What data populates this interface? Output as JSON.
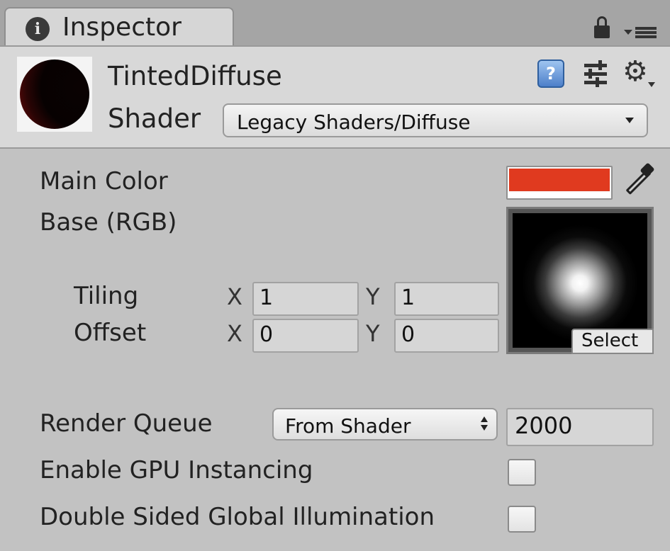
{
  "tab": {
    "title": "Inspector",
    "info_glyph": "i"
  },
  "header": {
    "material_name": "TintedDiffuse",
    "shader_label": "Shader",
    "shader_value": "Legacy Shaders/Diffuse",
    "help_glyph": "?"
  },
  "properties": {
    "main_color_label": "Main Color",
    "main_color_hex": "#e03a1f",
    "base_label": "Base (RGB)",
    "tiling_label": "Tiling",
    "offset_label": "Offset",
    "x_axis": "X",
    "y_axis": "Y",
    "tiling_x": "1",
    "tiling_y": "1",
    "offset_x": "0",
    "offset_y": "0",
    "texture_select_label": "Select"
  },
  "advanced": {
    "render_queue_label": "Render Queue",
    "render_queue_mode": "From Shader",
    "render_queue_value": "2000",
    "gpu_instancing_label": "Enable GPU Instancing",
    "gpu_instancing_checked": false,
    "double_sided_gi_label": "Double Sided Global Illumination",
    "double_sided_gi_checked": false
  },
  "icons": [
    "info-icon",
    "lock-icon",
    "panel-menu-icon",
    "help-icon",
    "preset-sliders-icon",
    "gear-icon",
    "eyedropper-icon",
    "dropdown-arrow-icon",
    "stepper-arrows-icon"
  ]
}
